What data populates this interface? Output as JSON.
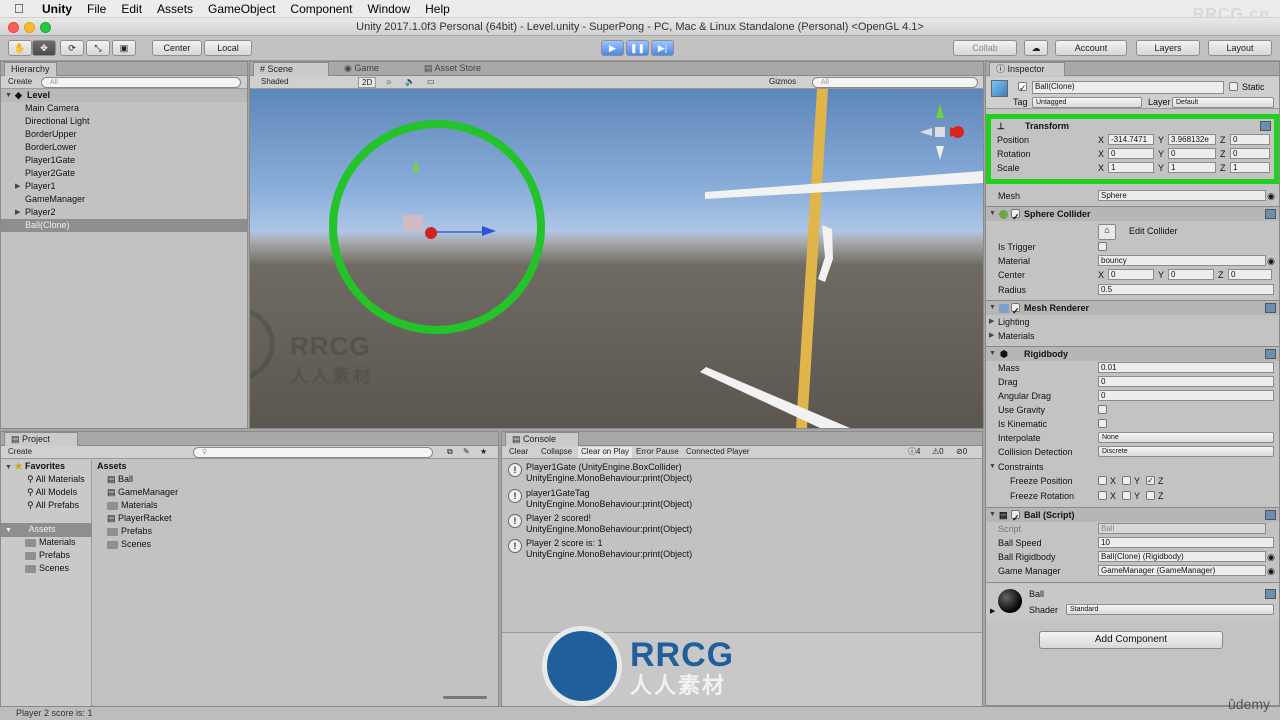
{
  "mac_menu": {
    "app": "Unity",
    "items": [
      "File",
      "Edit",
      "Assets",
      "GameObject",
      "Component",
      "Window",
      "Help"
    ]
  },
  "window_title": "Unity 2017.1.0f3 Personal (64bit) - Level.unity - SuperPong - PC, Mac & Linux Standalone (Personal) <OpenGL 4.1>",
  "watermark": "RRCG.cn",
  "toolbar": {
    "center": "Center",
    "local": "Local",
    "collab": "Collab",
    "account": "Account",
    "layers": "Layers",
    "layout": "Layout"
  },
  "hierarchy": {
    "tab": "Hierarchy",
    "create": "Create",
    "search": "All",
    "scene": "Level",
    "items": [
      "Main Camera",
      "Directional Light",
      "BorderUpper",
      "BorderLower",
      "Player1Gate",
      "Player2Gate",
      "Player1",
      "GameManager",
      "Player2",
      "Ball(Clone)"
    ]
  },
  "scene": {
    "tab": "Scene",
    "tab2": "Game",
    "tab3": "Asset Store",
    "shaded": "Shaded",
    "mode2d": "2D",
    "gizmos": "Gizmos",
    "search": "All",
    "watermark_logo": "RRCG",
    "watermark_cn": "人人素材"
  },
  "project": {
    "tab": "Project",
    "create": "Create",
    "favorites": "Favorites",
    "favorites_items": [
      "All Materials",
      "All Models",
      "All Prefabs"
    ],
    "assets": "Assets",
    "assets_folders": [
      "Materials",
      "Prefabs",
      "Scenes"
    ],
    "assets_header": "Assets",
    "assets_items": [
      "Ball",
      "GameManager",
      "Materials",
      "PlayerRacket",
      "Prefabs",
      "Scenes"
    ]
  },
  "console": {
    "tab": "Console",
    "buttons": [
      "Clear",
      "Collapse",
      "Clear on Play",
      "Error Pause",
      "Connected Player"
    ],
    "counts": [
      "4",
      "0",
      "0"
    ],
    "entries": [
      {
        "line1": "Player1Gate (UnityEngine.BoxCollider)",
        "line2": "UnityEngine.MonoBehaviour:print(Object)"
      },
      {
        "line1": "player1GateTag",
        "line2": "UnityEngine.MonoBehaviour:print(Object)"
      },
      {
        "line1": "Player 2 scored!",
        "line2": "UnityEngine.MonoBehaviour:print(Object)"
      },
      {
        "line1": "Player 2 score is: 1",
        "line2": "UnityEngine.MonoBehaviour:print(Object)"
      }
    ]
  },
  "inspector": {
    "tab": "Inspector",
    "object_name": "Ball(Clone)",
    "static_label": "Static",
    "tag_label": "Tag",
    "tag_value": "Untagged",
    "layer_label": "Layer",
    "layer_value": "Default",
    "transform": {
      "title": "Transform",
      "position_label": "Position",
      "rotation_label": "Rotation",
      "scale_label": "Scale",
      "position": {
        "x": "-314.7471",
        "y": "3.968132e",
        "z": "0"
      },
      "rotation": {
        "x": "0",
        "y": "0",
        "z": "0"
      },
      "scale": {
        "x": "1",
        "y": "1",
        "z": "1"
      },
      "highlight_color": "#1fd01f"
    },
    "mesh_label": "Mesh",
    "mesh_value": "Sphere",
    "sphere_collider": {
      "title": "Sphere Collider",
      "edit": "Edit Collider",
      "is_trigger_label": "Is Trigger",
      "material_label": "Material",
      "material_value": "bouncy",
      "center_label": "Center",
      "center": {
        "x": "0",
        "y": "0",
        "z": "0"
      },
      "radius_label": "Radius",
      "radius": "0.5"
    },
    "mesh_renderer": {
      "title": "Mesh Renderer",
      "lighting": "Lighting",
      "materials": "Materials"
    },
    "rigidbody": {
      "title": "Rigidbody",
      "mass_label": "Mass",
      "mass": "0.01",
      "drag_label": "Drag",
      "drag": "0",
      "angular_drag_label": "Angular Drag",
      "angular_drag": "0",
      "use_gravity_label": "Use Gravity",
      "is_kinematic_label": "Is Kinematic",
      "interpolate_label": "Interpolate",
      "interpolate": "None",
      "collision_label": "Collision Detection",
      "collision": "Discrete",
      "constraints_label": "Constraints",
      "freeze_pos_label": "Freeze Position",
      "freeze_rot_label": "Freeze Rotation",
      "x": "X",
      "y": "Y",
      "z": "Z"
    },
    "ball_script": {
      "title": "Ball (Script)",
      "script_label": "Script",
      "script_value": "Ball",
      "speed_label": "Ball Speed",
      "speed": "10",
      "rb_label": "Ball Rigidbody",
      "rb_value": "Ball(Clone) (Rigidbody)",
      "gm_label": "Game Manager",
      "gm_value": "GameManager (GameManager)"
    },
    "material": {
      "name": "Ball",
      "shader_label": "Shader",
      "shader": "Standard"
    },
    "add_component": "Add Component"
  },
  "status": "Player 2 score is: 1",
  "udemy": "ûdemy"
}
